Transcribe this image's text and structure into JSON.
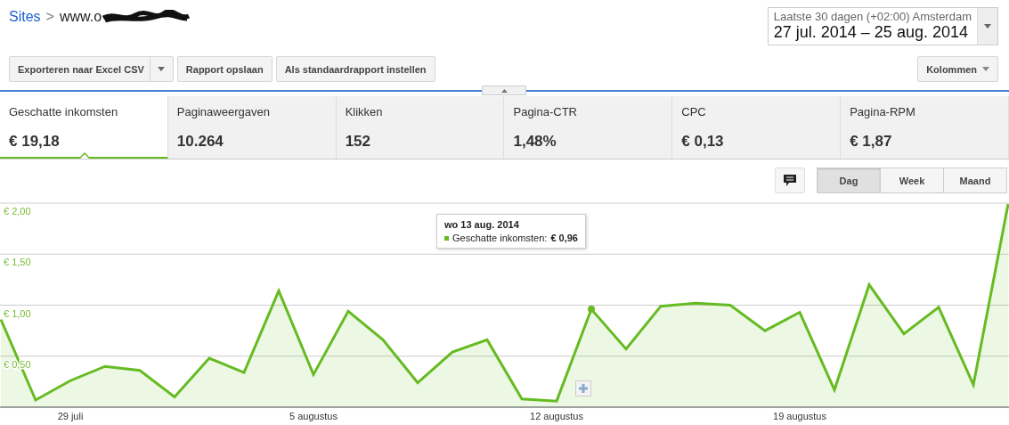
{
  "breadcrumb": {
    "root": "Sites",
    "separator": ">",
    "site": "www.o"
  },
  "date_range": {
    "preset": "Laatste 30 dagen (+02:00) Amsterdam",
    "range": "27 jul. 2014 – 25 aug. 2014"
  },
  "toolbar": {
    "buttons": [
      {
        "label": "Exporteren naar Excel CSV",
        "kind": "split"
      },
      {
        "label": "Rapport opslaan",
        "kind": "plain"
      },
      {
        "label": "Als standaardrapport instellen",
        "kind": "plain"
      }
    ],
    "columns_button": "Kolommen"
  },
  "metrics": [
    {
      "label": "Geschatte inkomsten",
      "value": "€ 19,18",
      "selected": true
    },
    {
      "label": "Paginaweergaven",
      "value": "10.264",
      "selected": false
    },
    {
      "label": "Klikken",
      "value": "152",
      "selected": false
    },
    {
      "label": "Pagina-CTR",
      "value": "1,48%",
      "selected": false
    },
    {
      "label": "CPC",
      "value": "€ 0,13",
      "selected": false
    },
    {
      "label": "Pagina-RPM",
      "value": "€ 1,87",
      "selected": false
    }
  ],
  "periods": [
    {
      "label": "Dag",
      "selected": true
    },
    {
      "label": "Week",
      "selected": false
    },
    {
      "label": "Maand",
      "selected": false
    }
  ],
  "chart": {
    "tooltip": {
      "title": "wo 13 aug. 2014",
      "series": "Geschatte inkomsten:",
      "value": "€ 0,96"
    },
    "chart_data": {
      "type": "area",
      "categories": [
        null,
        null,
        "29 juli",
        null,
        null,
        null,
        null,
        null,
        null,
        "5 augustus",
        null,
        null,
        null,
        null,
        null,
        null,
        "12 augustus",
        null,
        null,
        null,
        null,
        null,
        null,
        "19 augustus",
        null,
        null,
        null,
        null,
        null,
        null
      ],
      "series": [
        {
          "color": "#66bb22",
          "values": [
            0.86,
            0.07,
            0.26,
            0.4,
            0.36,
            0.1,
            0.48,
            0.34,
            1.14,
            0.32,
            0.94,
            0.66,
            0.24,
            0.54,
            0.66,
            0.08,
            0.06,
            0.96,
            0.57,
            0.99,
            1.02,
            1.0,
            0.75,
            0.93,
            0.17,
            1.2,
            0.72,
            0.98,
            0.22,
            1.99
          ]
        }
      ],
      "ylim": [
        0,
        2
      ],
      "grid": true,
      "yticks": [
        {
          "value": 0.5,
          "label": "€ 0,50"
        },
        {
          "value": 1,
          "label": "€ 1,00"
        },
        {
          "value": 1.5,
          "label": "€ 1,50"
        },
        {
          "value": 2,
          "label": "€ 2,00"
        }
      ]
    }
  }
}
